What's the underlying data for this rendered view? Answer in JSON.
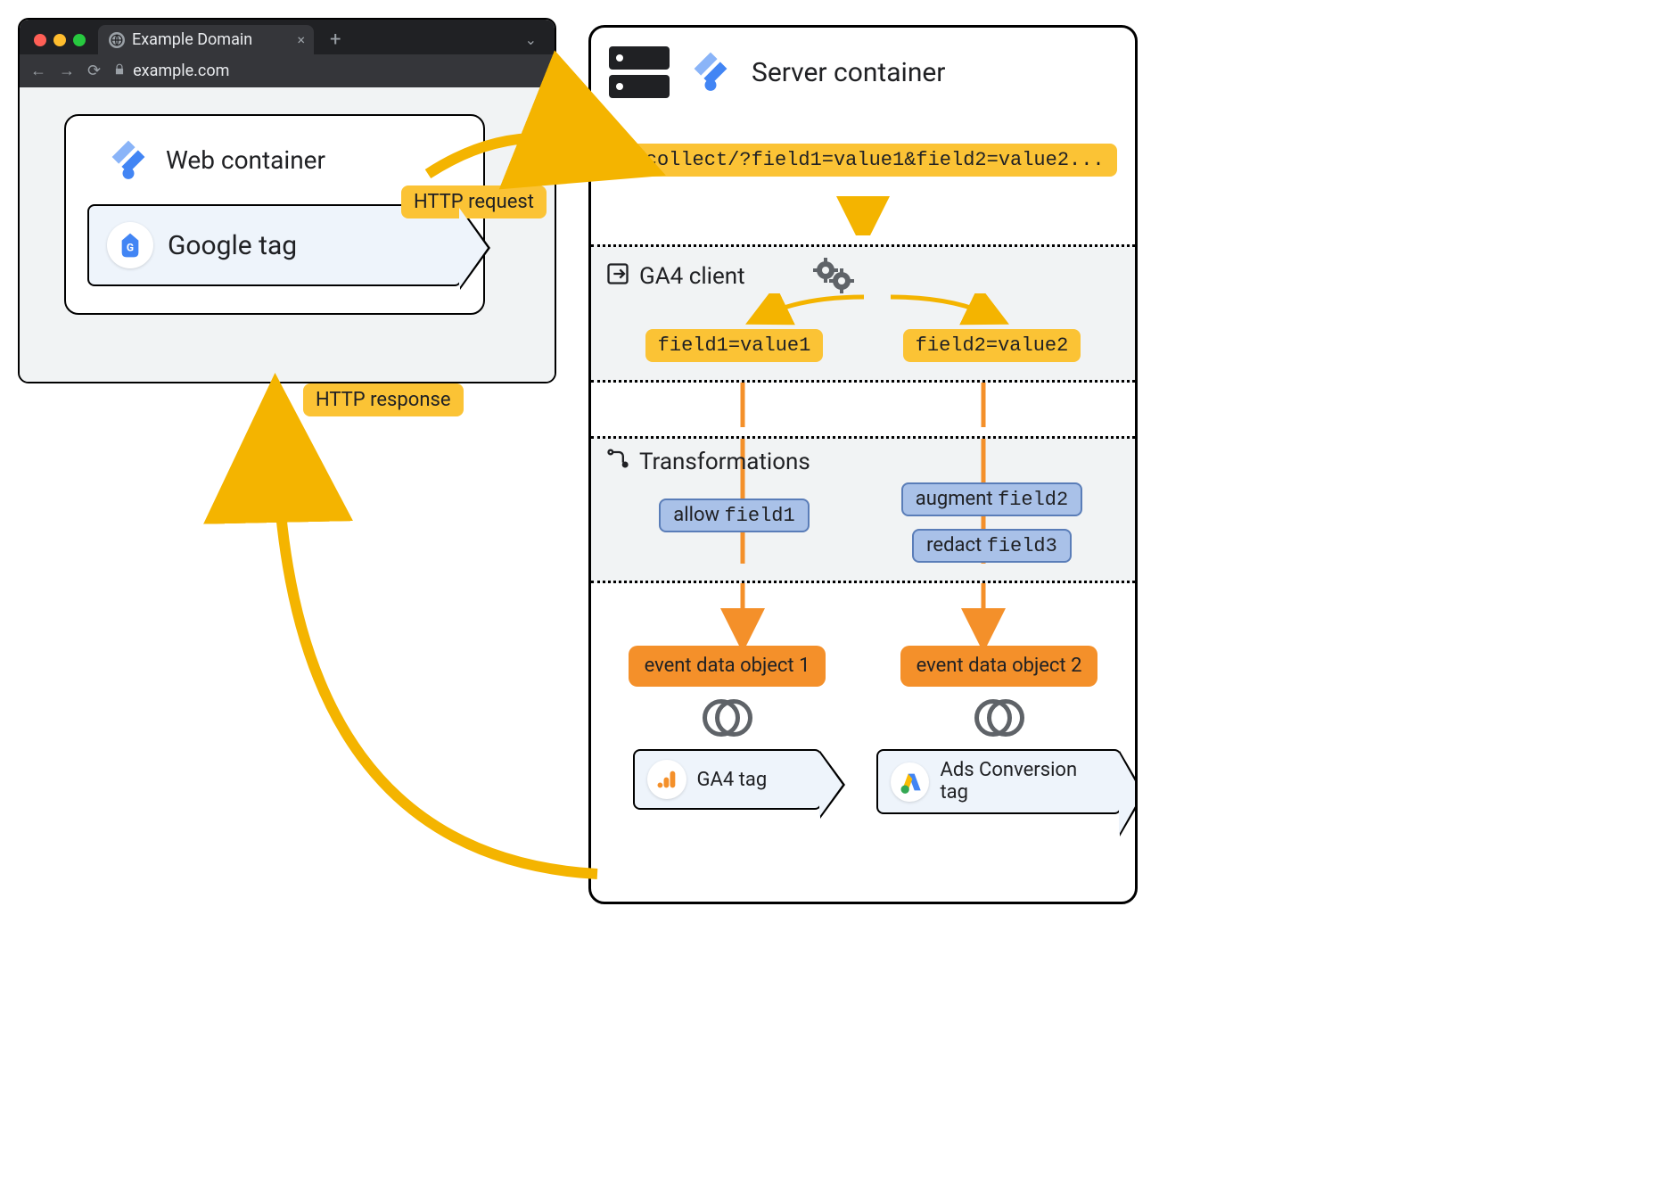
{
  "browser": {
    "tab_title": "Example Domain",
    "address": "example.com"
  },
  "web_container": {
    "title": "Web container",
    "tag_label": "Google tag"
  },
  "http": {
    "request": "HTTP request",
    "response": "HTTP response"
  },
  "server": {
    "title": "Server container",
    "collect_url": "g/collect/?field1=value1&field2=value2...",
    "ga4_client_title": "GA4 client",
    "field1": "field1=value1",
    "field2": "field2=value2",
    "transformations_title": "Transformations",
    "transform_allow": "allow field1",
    "transform_augment": "augment field2",
    "transform_redact": "redact field3",
    "event_obj1": "event data object 1",
    "event_obj2": "event data object 2",
    "ga4_tag": "GA4 tag",
    "ads_tag": "Ads Conversion tag"
  }
}
